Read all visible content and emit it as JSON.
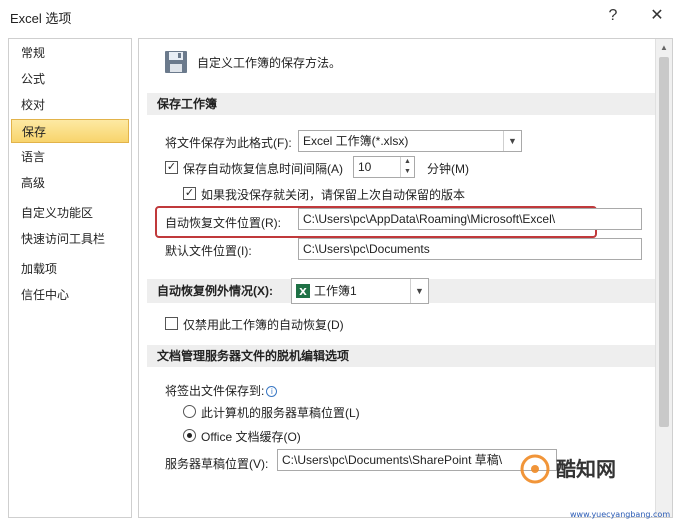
{
  "window": {
    "title": "Excel 选项"
  },
  "sidebar": {
    "items": [
      {
        "label": "常规"
      },
      {
        "label": "公式"
      },
      {
        "label": "校对"
      },
      {
        "label": "保存",
        "active": true
      },
      {
        "label": "语言"
      },
      {
        "label": "高级"
      },
      {
        "label": "自定义功能区"
      },
      {
        "label": "快速访问工具栏"
      },
      {
        "label": "加载项"
      },
      {
        "label": "信任中心"
      }
    ]
  },
  "main": {
    "header_text": "自定义工作簿的保存方法。",
    "save_section": {
      "title": "保存工作簿",
      "format_label": "将文件保存为此格式(F):",
      "format_value": "Excel 工作簿(*.xlsx)",
      "autorecover_label": "保存自动恢复信息时间间隔(A)",
      "autorecover_checked": true,
      "autorecover_minutes": "10",
      "minutes_label": "分钟(M)",
      "keep_last_label": "如果我没保存就关闭，请保留上次自动保留的版本",
      "keep_last_checked": true,
      "autorecover_location_label": "自动恢复文件位置(R):",
      "autorecover_location_value": "C:\\Users\\pc\\AppData\\Roaming\\Microsoft\\Excel\\",
      "default_location_label": "默认文件位置(I):",
      "default_location_value": "C:\\Users\\pc\\Documents"
    },
    "exceptions_section": {
      "title": "自动恢复例外情况(X):",
      "workbook_value": "工作簿1",
      "disable_label": "仅禁用此工作簿的自动恢复(D)",
      "disable_checked": false
    },
    "offline_section": {
      "title": "文档管理服务器文件的脱机编辑选项",
      "checkout_label": "将签出文件保存到:",
      "option_server_label": "此计算机的服务器草稿位置(L)",
      "option_cache_label": "Office 文档缓存(O)",
      "selected": "cache",
      "drafts_label": "服务器草稿位置(V):",
      "drafts_value": "C:\\Users\\pc\\Documents\\SharePoint 草稿\\"
    }
  },
  "watermark": {
    "text_top": "酷知网",
    "text_bottom": "www.yuecyangbang.com"
  },
  "colors": {
    "active_bg": "#f8d46c",
    "highlight_border": "#c0393b",
    "section_bg": "#eeeeee"
  }
}
